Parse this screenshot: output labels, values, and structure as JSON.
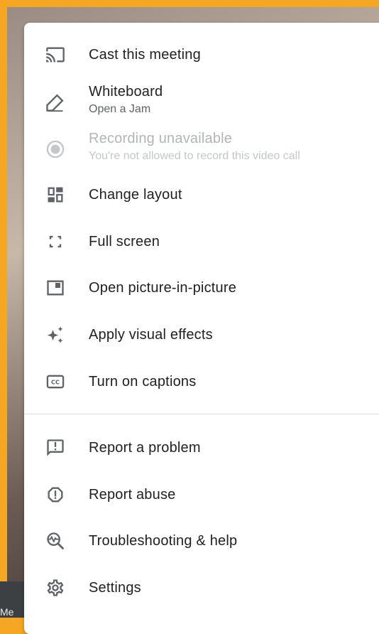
{
  "background": {
    "frame_color": "#F5A623",
    "corner_text": "Me"
  },
  "menu": {
    "items": [
      {
        "label": "Cast this meeting",
        "icon": "cast-icon"
      },
      {
        "label": "Whiteboard",
        "sublabel": "Open a Jam",
        "icon": "pencil-icon"
      },
      {
        "label": "Recording unavailable",
        "sublabel": "You're not allowed to record this video call",
        "icon": "record-icon",
        "disabled": true
      },
      {
        "label": "Change layout",
        "icon": "layout-icon"
      },
      {
        "label": "Full screen",
        "icon": "fullscreen-icon"
      },
      {
        "label": "Open picture-in-picture",
        "icon": "picture-in-picture-icon"
      },
      {
        "label": "Apply visual effects",
        "icon": "sparkle-icon"
      },
      {
        "label": "Turn on captions",
        "icon": "captions-icon"
      },
      {
        "label": "Report a problem",
        "icon": "feedback-icon"
      },
      {
        "label": "Report abuse",
        "icon": "report-abuse-icon"
      },
      {
        "label": "Troubleshooting & help",
        "icon": "troubleshoot-icon"
      },
      {
        "label": "Settings",
        "icon": "gear-icon"
      }
    ]
  }
}
